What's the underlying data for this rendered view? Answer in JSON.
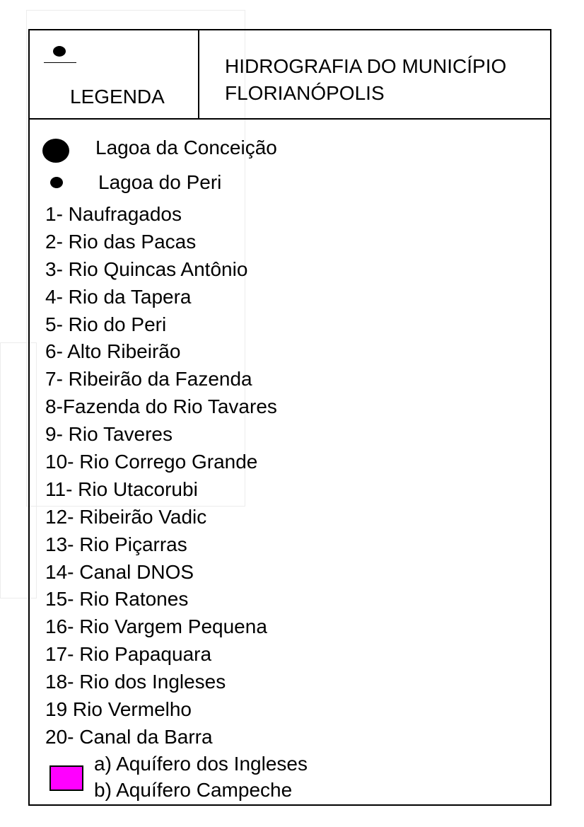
{
  "header": {
    "legend_label": "LEGENDA",
    "title_line1": "HIDROGRAFIA DO MUNICÍPIO",
    "title_line2": "FLORIANÓPOLIS"
  },
  "lakes": [
    {
      "label": "Lagoa da Conceição",
      "symbol": "large-filled-circle"
    },
    {
      "label": "Lagoa do Peri",
      "symbol": "small-filled-circle"
    }
  ],
  "rivers": [
    "1- Naufragados",
    "2- Rio das Pacas",
    "3- Rio Quincas Antônio",
    "4- Rio da Tapera",
    "5- Rio do Peri",
    "6- Alto Ribeirão",
    "7- Ribeirão da Fazenda",
    "8-Fazenda do Rio Tavares",
    "9- Rio Taveres",
    "10- Rio Corrego Grande",
    "11- Rio Utacorubi",
    "12- Ribeirão Vadic",
    "13- Rio Piçarras",
    "14- Canal DNOS",
    "15- Rio Ratones",
    "16- Rio Vargem Pequena",
    "17- Rio Papaquara",
    "18- Rio dos Ingleses",
    "19 Rio Vermelho",
    "20- Canal da Barra"
  ],
  "aquifers": {
    "swatch_color": "#ff00ff",
    "items": [
      "a) Aquífero dos Ingleses",
      "b) Aquífero Campeche"
    ]
  }
}
